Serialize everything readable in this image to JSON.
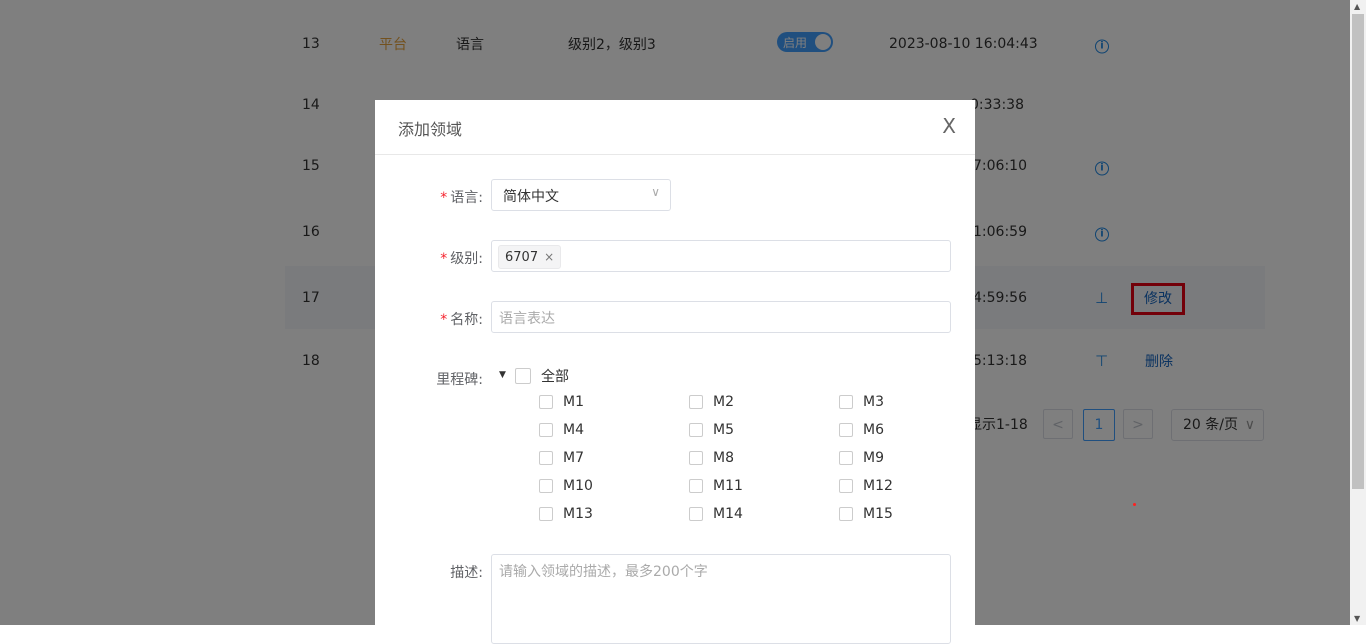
{
  "table": {
    "rows": [
      {
        "idx": "13",
        "type": "平台",
        "name": "语言",
        "level": "级别2，级别3",
        "switch": "启用",
        "time": "2023-08-10 16:04:43",
        "icon": "info-icon",
        "op": ""
      },
      {
        "idx": "14",
        "type": "",
        "name": "",
        "level": "",
        "switch": "",
        "time": "0:33:38",
        "icon": "",
        "op": ""
      },
      {
        "idx": "15",
        "type": "",
        "name": "",
        "level": "",
        "switch": "",
        "time": "7:06:10",
        "icon": "info-icon",
        "op": ""
      },
      {
        "idx": "16",
        "type": "",
        "name": "",
        "level": "",
        "switch": "",
        "time": "1:06:59",
        "icon": "info-icon",
        "op": ""
      },
      {
        "idx": "17",
        "type": "",
        "name": "",
        "level": "",
        "switch": "",
        "time": "4:59:56",
        "icon": "move-down-icon",
        "op": "修改"
      },
      {
        "idx": "18",
        "type": "",
        "name": "",
        "level": "",
        "switch": "",
        "time": "5:13:18",
        "icon": "move-top-icon",
        "op": "删除"
      }
    ]
  },
  "pagination": {
    "total_text": "显示1-18",
    "prev": "<",
    "current_page": "1",
    "next": ">",
    "page_size": "20 条/页"
  },
  "dialog": {
    "title": "添加领域",
    "close": "X",
    "language": {
      "required": "*",
      "label": "语言:",
      "value": "简体中文"
    },
    "level": {
      "required": "*",
      "label": "级别:",
      "tag": "6707",
      "tag_remove": "×"
    },
    "name": {
      "required": "*",
      "label": "名称:",
      "placeholder": "语言表达"
    },
    "milestone": {
      "label": "里程碑:",
      "all": "全部",
      "items": [
        "M1",
        "M2",
        "M3",
        "M4",
        "M5",
        "M6",
        "M7",
        "M8",
        "M9",
        "M10",
        "M11",
        "M12",
        "M13",
        "M14",
        "M15"
      ]
    },
    "description": {
      "label": "描述:",
      "placeholder": "请输入领域的描述，最多200个字"
    }
  },
  "colors": {
    "accent": "#409eff",
    "link": "#1565c0",
    "highlight_border": "#e60012",
    "type_orange": "#e6a23c"
  }
}
